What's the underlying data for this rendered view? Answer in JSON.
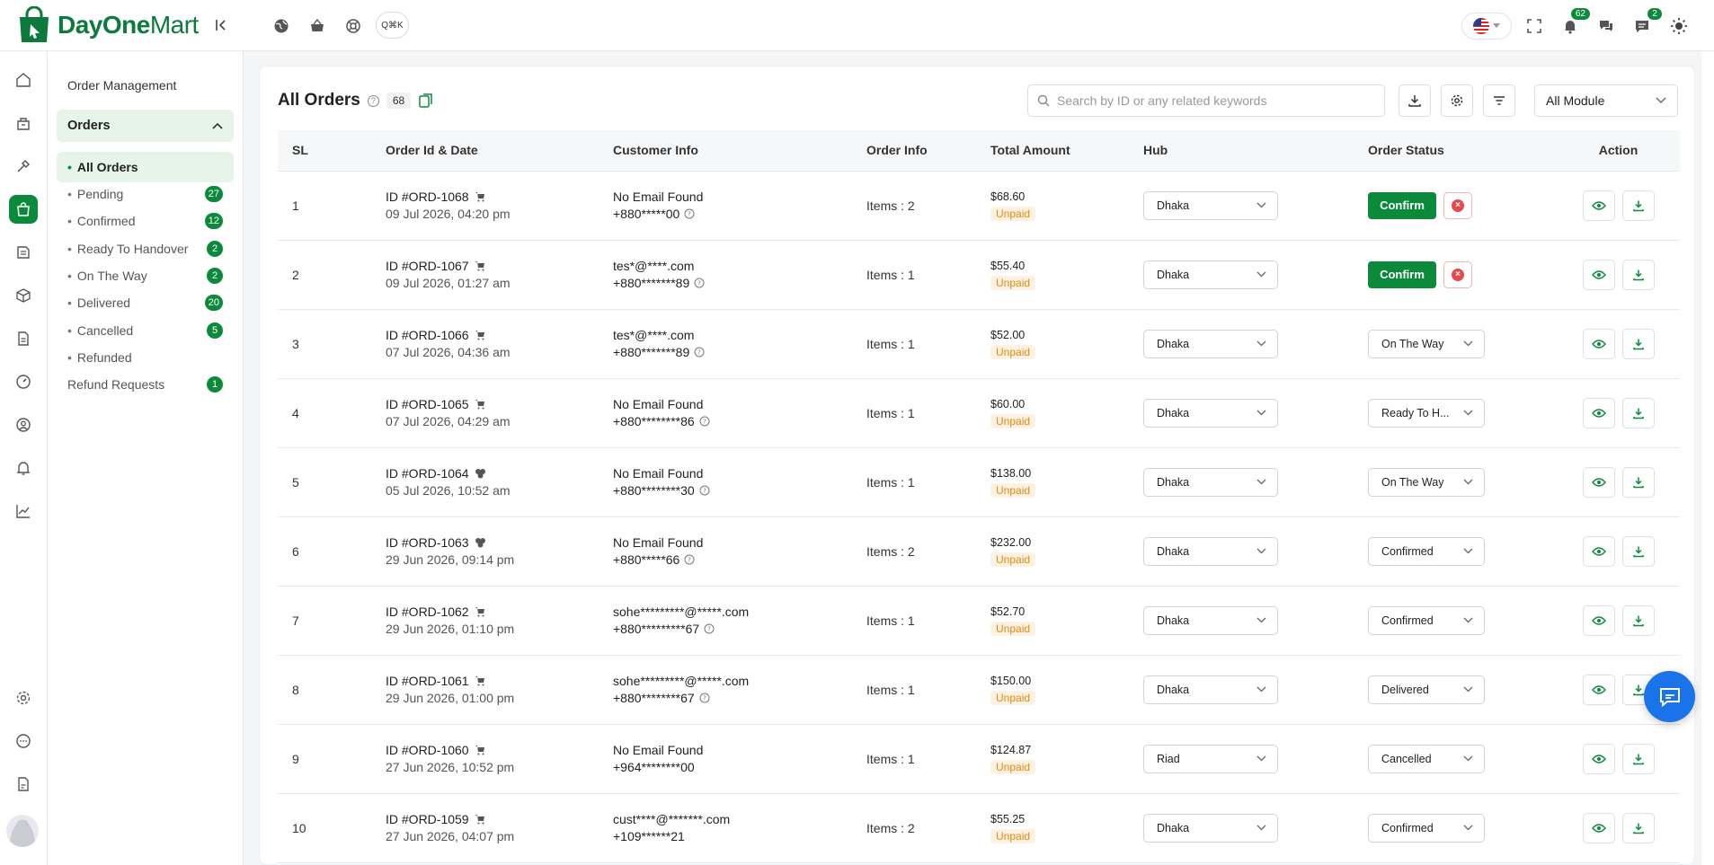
{
  "brand": {
    "name_bold": "DayOne",
    "name_rest": "Mart"
  },
  "topbar": {
    "search_pill_label": "Q⌘K",
    "notifications_count": "62",
    "messages_count": "2"
  },
  "sidebar": {
    "title": "Order Management",
    "group_label": "Orders",
    "items": [
      {
        "label": "All Orders",
        "count": ""
      },
      {
        "label": "Pending",
        "count": "27"
      },
      {
        "label": "Confirmed",
        "count": "12"
      },
      {
        "label": "Ready To Handover",
        "count": "2"
      },
      {
        "label": "On The Way",
        "count": "2"
      },
      {
        "label": "Delivered",
        "count": "20"
      },
      {
        "label": "Cancelled",
        "count": "5"
      },
      {
        "label": "Refunded",
        "count": ""
      }
    ],
    "refund": {
      "label": "Refund Requests",
      "count": "1"
    }
  },
  "main": {
    "title": "All Orders",
    "count": "68",
    "search_placeholder": "Search by ID or any related keywords",
    "module_select": "All Module",
    "columns": [
      "SL",
      "Order Id & Date",
      "Customer Info",
      "Order Info",
      "Total Amount",
      "Hub",
      "Order Status",
      "Action"
    ],
    "rows": [
      {
        "sl": "1",
        "id": "ID #ORD-1068",
        "date": "09 Jul 2026, 04:20 pm",
        "email": "No Email Found",
        "phone": "+880*****00",
        "items": "Items : 2",
        "amount": "$68.60",
        "payment": "Unpaid",
        "hub": "Dhaka",
        "status": "",
        "confirm": "Confirm"
      },
      {
        "sl": "2",
        "id": "ID #ORD-1067",
        "date": "09 Jul 2026, 01:27 am",
        "email": "tes*@****.com",
        "phone": "+880*******89",
        "items": "Items : 1",
        "amount": "$55.40",
        "payment": "Unpaid",
        "hub": "Dhaka",
        "status": "",
        "confirm": "Confirm"
      },
      {
        "sl": "3",
        "id": "ID #ORD-1066",
        "date": "07 Jul 2026, 04:36 am",
        "email": "tes*@****.com",
        "phone": "+880*******89",
        "items": "Items : 1",
        "amount": "$52.00",
        "payment": "Unpaid",
        "hub": "Dhaka",
        "status": "On The Way",
        "confirm": ""
      },
      {
        "sl": "4",
        "id": "ID #ORD-1065",
        "date": "07 Jul 2026, 04:29 am",
        "email": "No Email Found",
        "phone": "+880********86",
        "items": "Items : 1",
        "amount": "$60.00",
        "payment": "Unpaid",
        "hub": "Dhaka",
        "status": "Ready To H...",
        "confirm": ""
      },
      {
        "sl": "5",
        "id": "ID #ORD-1064",
        "date": "05 Jul 2026, 10:52 am",
        "email": "No Email Found",
        "phone": "+880********30",
        "items": "Items : 1",
        "amount": "$138.00",
        "payment": "Unpaid",
        "hub": "Dhaka",
        "status": "On The Way",
        "confirm": ""
      },
      {
        "sl": "6",
        "id": "ID #ORD-1063",
        "date": "29 Jun 2026, 09:14 pm",
        "email": "No Email Found",
        "phone": "+880*****66",
        "items": "Items : 2",
        "amount": "$232.00",
        "payment": "Unpaid",
        "hub": "Dhaka",
        "status": "Confirmed",
        "confirm": ""
      },
      {
        "sl": "7",
        "id": "ID #ORD-1062",
        "date": "29 Jun 2026, 01:10 pm",
        "email": "sohe*********@*****.com",
        "phone": "+880*********67",
        "items": "Items : 1",
        "amount": "$52.70",
        "payment": "Unpaid",
        "hub": "Dhaka",
        "status": "Confirmed",
        "confirm": ""
      },
      {
        "sl": "8",
        "id": "ID #ORD-1061",
        "date": "29 Jun 2026, 01:00 pm",
        "email": "sohe*********@*****.com",
        "phone": "+880********67",
        "items": "Items : 1",
        "amount": "$150.00",
        "payment": "Unpaid",
        "hub": "Dhaka",
        "status": "Delivered",
        "confirm": ""
      },
      {
        "sl": "9",
        "id": "ID #ORD-1060",
        "date": "27 Jun 2026, 10:52 pm",
        "email": "No Email Found",
        "phone": "+964********00",
        "items": "Items : 1",
        "amount": "$124.87",
        "payment": "Unpaid",
        "hub": "Riad",
        "status": "Cancelled",
        "confirm": ""
      },
      {
        "sl": "10",
        "id": "ID #ORD-1059",
        "date": "27 Jun 2026, 04:07 pm",
        "email": "cust****@*******.com",
        "phone": "+109******21",
        "items": "Items : 2",
        "amount": "$55.25",
        "payment": "Unpaid",
        "hub": "Dhaka",
        "status": "Confirmed",
        "confirm": ""
      }
    ]
  },
  "colors": {
    "brand_green": "#0b8a3c",
    "unpaid_text": "#e08b14",
    "unpaid_bg": "#fdf1e1",
    "danger": "#e5484d",
    "chat_blue": "#1a73e8"
  }
}
